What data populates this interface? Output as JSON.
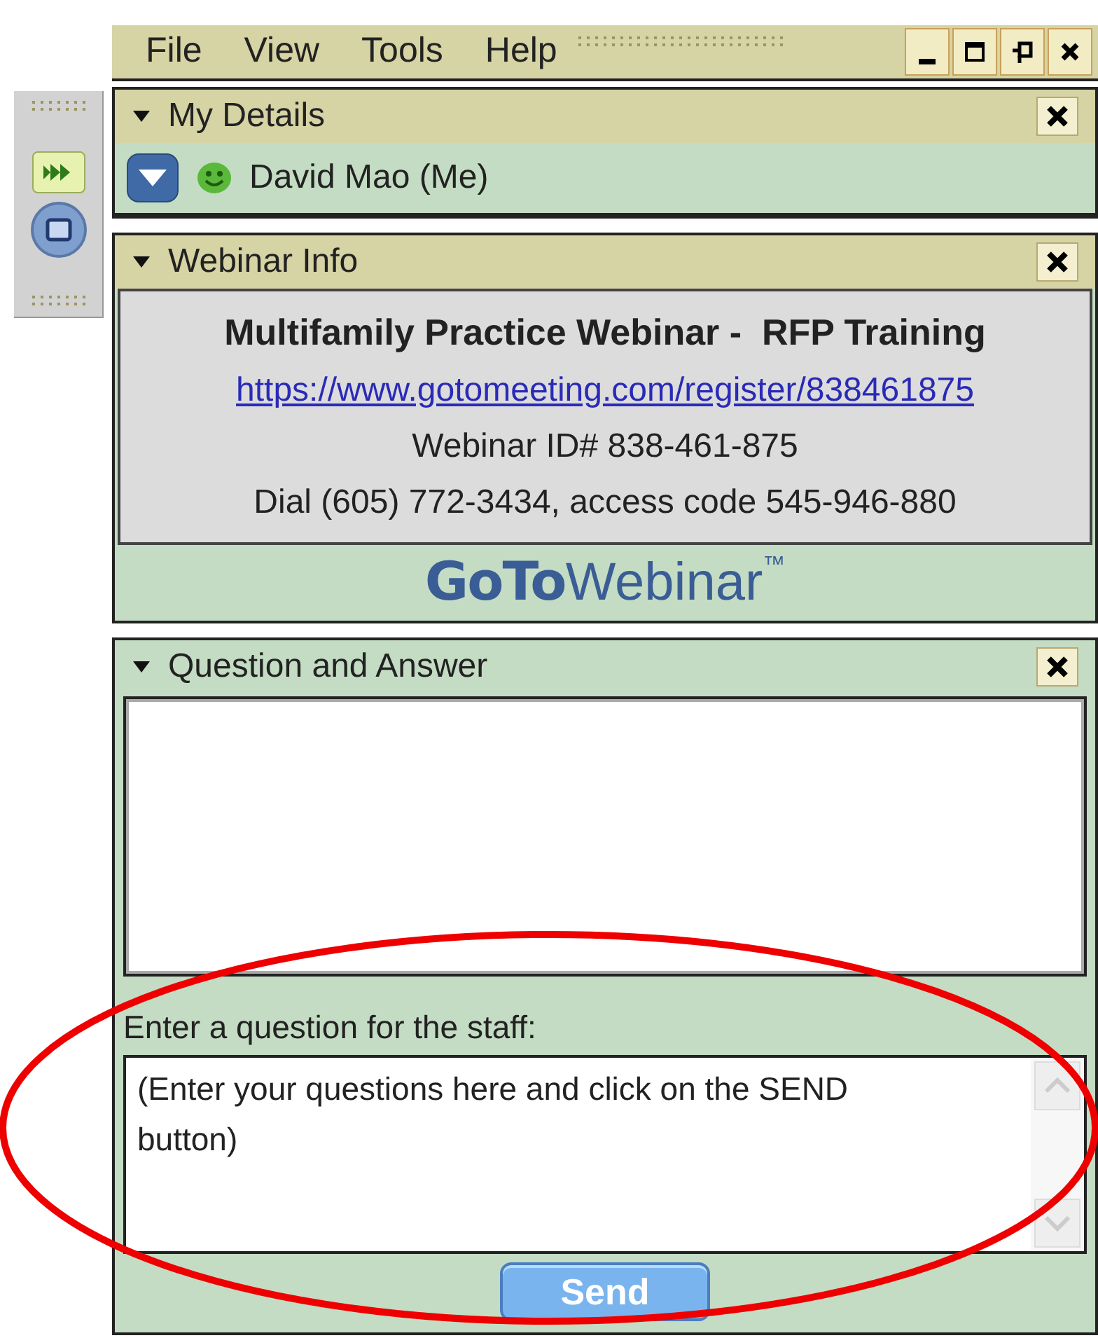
{
  "menu": [
    "File",
    "View",
    "Tools",
    "Help"
  ],
  "window_controls": [
    {
      "kind": "minimize"
    },
    {
      "kind": "maximize"
    },
    {
      "kind": "pin"
    },
    {
      "kind": "close"
    }
  ],
  "side_toolbar": [
    {
      "kind": "forward"
    },
    {
      "kind": "window"
    }
  ],
  "panels": [
    {
      "kind": "details",
      "title": "My Details",
      "expanded": true,
      "user": "David Mao (Me)"
    },
    {
      "kind": "info",
      "title": "Webinar Info",
      "expanded": true,
      "heading": "Multifamily Practice Webinar -  RFP Training",
      "link": "https://www.gotomeeting.com/register/838461875",
      "id_line": "Webinar ID# 838-461-875",
      "dial_line": "Dial (605) 772-3434, access code 545-946-880",
      "logo": {
        "bold": "GoTo",
        "light": "Webinar",
        "mark": "™"
      }
    },
    {
      "kind": "qa",
      "title": "Question and Answer",
      "expanded": true,
      "prompt": "Enter a question for the staff:",
      "placeholder": "(Enter your questions here and click on the SEND button)",
      "send": "Send"
    }
  ],
  "annotation": {
    "kind": "ellipse",
    "color": "#ee0000"
  }
}
